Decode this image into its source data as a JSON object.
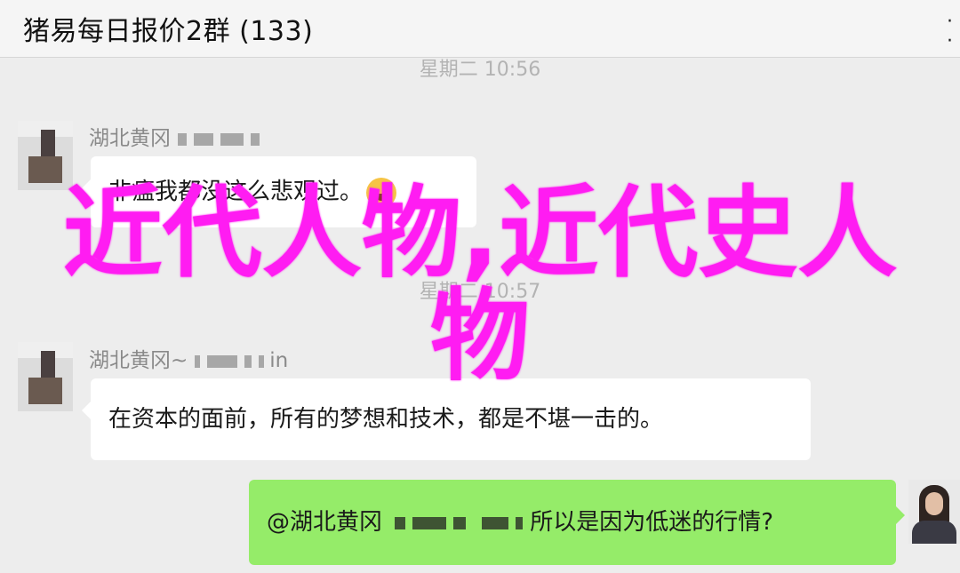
{
  "header": {
    "title": "猪易每日报价2群 (133)",
    "more_icon": "more-dots-icon"
  },
  "messages": [
    {
      "time": "星期二 10:56",
      "sender": "湖北黄冈",
      "text": "非瘟我都没这么悲观过。",
      "emoji": "laugh-cry"
    },
    {
      "time": "星期二 10:57",
      "sender": "湖北黄冈~",
      "sender_suffix": "in",
      "text": "在资本的面前，所有的梦想和技术，都是不堪一击的。"
    },
    {
      "mention": "@湖北黄冈",
      "text": "所以是因为低迷的行情?"
    }
  ],
  "overlay": {
    "line1": "近代人物,近代史人",
    "line2": "物"
  },
  "colors": {
    "overlay": "#ff1cf2",
    "self_bubble": "#95ec69",
    "background": "#ededed"
  }
}
